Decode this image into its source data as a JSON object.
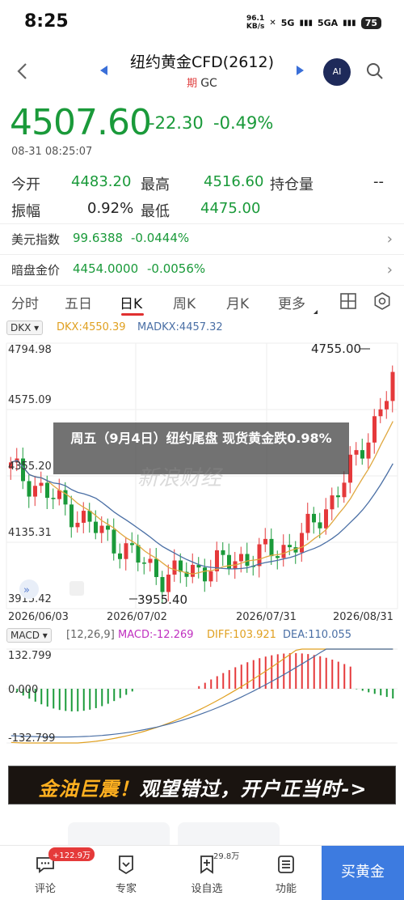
{
  "status": {
    "time": "8:25",
    "net_speed_value": "96.1",
    "net_speed_unit": "KB/s",
    "signal1": "5G",
    "signal2": "5GA",
    "battery": "75"
  },
  "header": {
    "title": "纽约黄金CFD(2612)",
    "period_badge": "期",
    "symbol": "GC",
    "ai_label": "AI"
  },
  "quote": {
    "price": "4507.60",
    "change": "-22.30",
    "change_pct": "-0.49%",
    "timestamp": "08-31 08:25:07"
  },
  "stats": {
    "open_label": "今开",
    "open": "4483.20",
    "high_label": "最高",
    "high": "4516.60",
    "oi_label": "持仓量",
    "oi": "--",
    "amp_label": "振幅",
    "amp": "0.92%",
    "low_label": "最低",
    "low": "4475.00"
  },
  "refs": [
    {
      "label": "美元指数",
      "value": "99.6388",
      "change": "-0.0444%"
    },
    {
      "label": "暗盘金价",
      "value": "4454.0000",
      "change": "-0.0056%"
    }
  ],
  "tabs": [
    "分时",
    "五日",
    "日K",
    "周K",
    "月K",
    "更多"
  ],
  "indicator": {
    "select": "DKX",
    "dkx_label": "DKX:4550.39",
    "madkx_label": "MADKX:4457.32"
  },
  "macd": {
    "select": "MACD",
    "params": "[12,26,9]",
    "macd_label": "MACD:-12.269",
    "diff_label": "DIFF:103.921",
    "dea_label": "DEA:110.055",
    "y_ticks": [
      "132.799",
      "0.000",
      "-132.799"
    ]
  },
  "chart_data": {
    "type": "candlestick",
    "y_ticks": [
      "4794.98",
      "4575.09",
      "4355.20",
      "4135.31",
      "3915.42"
    ],
    "x_ticks": [
      "2026/06/03",
      "2026/07/02",
      "2026/07/31",
      "2026/08/31"
    ],
    "ylim": [
      3915.42,
      4794.98
    ],
    "annotations": {
      "max": "4755.00",
      "min": "3955.40"
    },
    "colors": {
      "up": "#e5393b",
      "down": "#1a9a3a",
      "dkx": "#e0a840",
      "madkx": "#4a6fa5"
    }
  },
  "news": {
    "headline": "周五（9月4日）纽约尾盘 现货黄金跌0.98%",
    "watermark": "新浪财经"
  },
  "ad": {
    "text_a": "金油巨震！",
    "text_b": "观望错过，开户正当时->"
  },
  "nav": {
    "comment_label": "评论",
    "comment_badge": "+122.9万",
    "expert_label": "专家",
    "vote_label": "设自选",
    "vote_count": "29.8万",
    "func_label": "功能",
    "buy_label": "买黄金"
  }
}
